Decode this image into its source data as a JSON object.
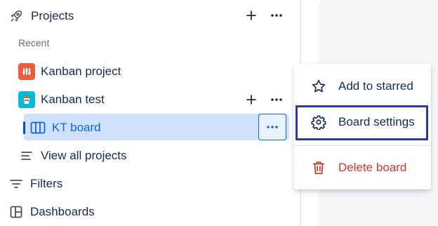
{
  "sidebar": {
    "projects_label": "Projects",
    "recent_label": "Recent",
    "projects": [
      {
        "name": "Kanban project",
        "icon": "kanban-project-avatar",
        "color": "#ef5b3b"
      },
      {
        "name": "Kanban test",
        "icon": "kanban-test-avatar",
        "color": "#00b8d9"
      }
    ],
    "board": {
      "name": "KT board",
      "icon": "board-columns-icon"
    },
    "view_all": "View all projects",
    "filters": "Filters",
    "dashboards": "Dashboards"
  },
  "menu": {
    "items": [
      {
        "label": "Add to starred",
        "icon": "star-icon"
      },
      {
        "label": "Board settings",
        "icon": "gear-icon"
      },
      {
        "label": "Delete board",
        "icon": "trash-icon"
      }
    ]
  },
  "colors": {
    "accent": "#0c66e4",
    "selected_bg": "#cfe1fd",
    "danger": "#c9372c",
    "highlight_border": "#2b3a9e"
  }
}
